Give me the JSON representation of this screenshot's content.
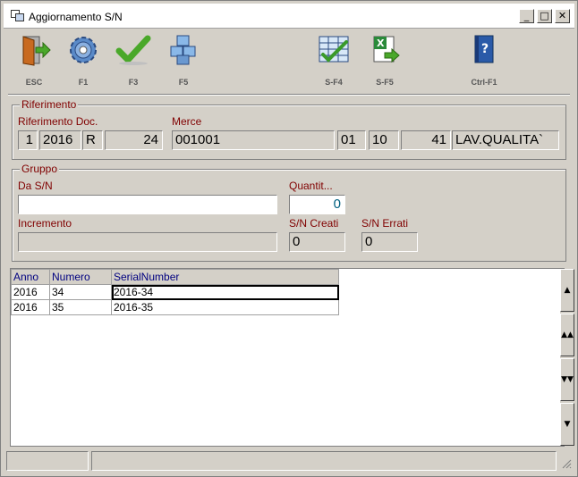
{
  "window": {
    "title": "Aggiornamento S/N"
  },
  "titlebar_buttons": {
    "minimize": "_",
    "maximize": "□",
    "close": "✕"
  },
  "toolbar": [
    {
      "key": "ESC",
      "icon": "exit-door-icon"
    },
    {
      "key": "F1",
      "icon": "gear-icon"
    },
    {
      "key": "F3",
      "icon": "checkmark-icon"
    },
    {
      "key": "F5",
      "icon": "cubes-icon"
    },
    {
      "key": "S-F4",
      "icon": "grid-check-icon"
    },
    {
      "key": "S-F5",
      "icon": "excel-export-icon"
    },
    {
      "key": "Ctrl-F1",
      "icon": "help-book-icon"
    }
  ],
  "riferimento": {
    "group_label": "Riferimento",
    "doc_label": "Riferimento Doc.",
    "merce_label": "Merce",
    "doc_fields": [
      "1",
      "2016",
      "R",
      "24"
    ],
    "merce_code": "001001",
    "merce_fields": [
      "01",
      "10",
      "41"
    ],
    "merce_desc": "LAV.QUALITA`"
  },
  "gruppo": {
    "group_label": "Gruppo",
    "da_sn_label": "Da S/N",
    "da_sn_value": "",
    "quantita_label": "Quantit...",
    "quantita_value": "0",
    "incremento_label": "Incremento",
    "incremento_value": "",
    "sn_creati_label": "S/N Creati",
    "sn_creati_value": "0",
    "sn_errati_label": "S/N Errati",
    "sn_errati_value": "0"
  },
  "grid": {
    "columns": [
      "Anno",
      "Numero",
      "SerialNumber"
    ],
    "rows": [
      [
        "2016",
        "34",
        "2016-34"
      ],
      [
        "2016",
        "35",
        "2016-35"
      ]
    ]
  },
  "scrollbar": {
    "up": "▲",
    "page_up": "▲▲",
    "page_down": "▼▼",
    "down": "▼"
  },
  "colors": {
    "label": "#800000",
    "header": "#000080",
    "background": "#d4d0c8"
  }
}
